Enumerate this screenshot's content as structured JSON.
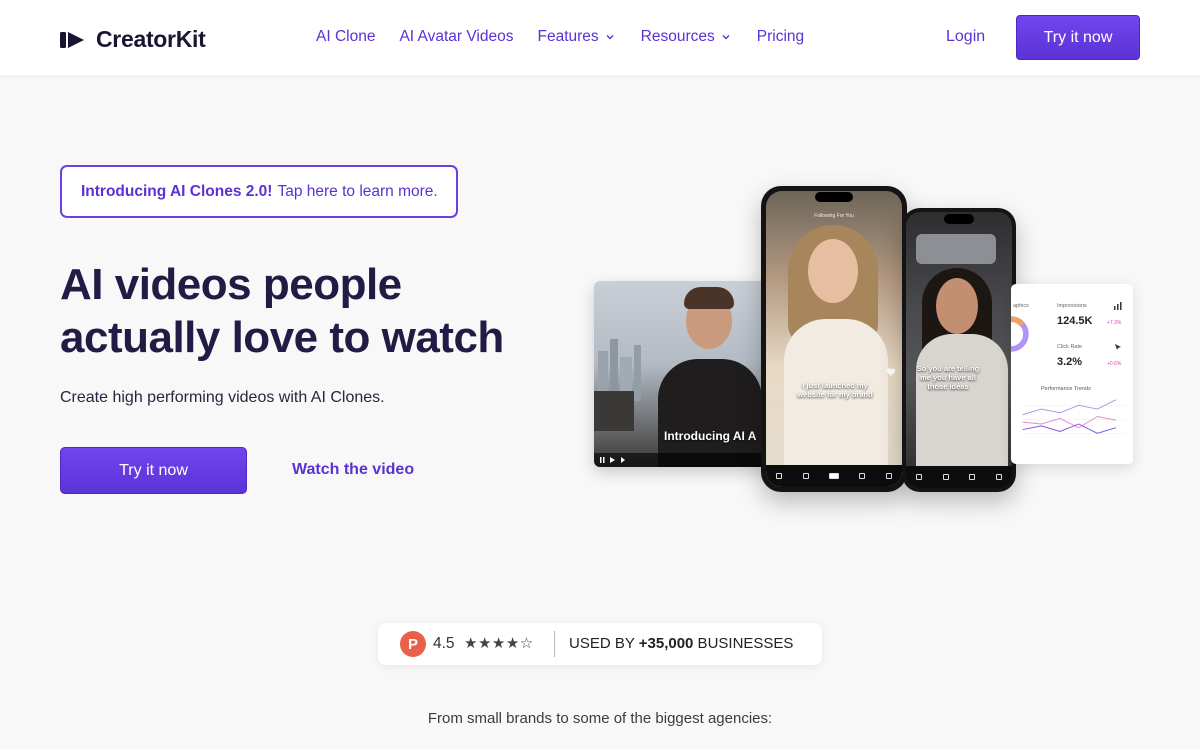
{
  "header": {
    "brand": "CreatorKit",
    "nav": [
      {
        "label": "AI Clone",
        "has_dropdown": false
      },
      {
        "label": "AI Avatar Videos",
        "has_dropdown": false
      },
      {
        "label": "Features",
        "has_dropdown": true
      },
      {
        "label": "Resources",
        "has_dropdown": true
      },
      {
        "label": "Pricing",
        "has_dropdown": false
      }
    ],
    "login_label": "Login",
    "cta_label": "Try it now"
  },
  "hero": {
    "intro_strong": "Introducing AI Clones 2.0!",
    "intro_rest": "Tap here to learn more.",
    "title_line1": "AI videos people",
    "title_line2": "actually love to watch",
    "subtitle": "Create high performing videos with AI Clones.",
    "cta_label": "Try it now",
    "watch_label": "Watch the video"
  },
  "mockup": {
    "video_caption": "Introducing AI A",
    "phone1_caption": "I just launched my website for my brand",
    "phone1_tabs": "Following  For You",
    "phone2_caption": "So you are telling me you have all those ideas",
    "analytics": {
      "impressions_label": "Impressions",
      "impressions_value": "124.5K",
      "impressions_delta": "+7.3%",
      "click_rate_label": "Click Rate",
      "click_rate_value": "3.2%",
      "click_rate_delta": "+0.6%",
      "trends_label": "Performance Trends",
      "graphics_label": "aphics"
    }
  },
  "social_proof": {
    "score": "4.5",
    "stars": "★★★★☆",
    "used_by_prefix": "USED BY ",
    "used_by_count": "+35,000",
    "used_by_suffix": " BUSINESSES",
    "badge_letter": "P"
  },
  "tagline": "From small brands to some of the biggest agencies:",
  "colors": {
    "accent": "#5b31d4",
    "title": "#231b45",
    "producthunt": "#e8604a"
  }
}
